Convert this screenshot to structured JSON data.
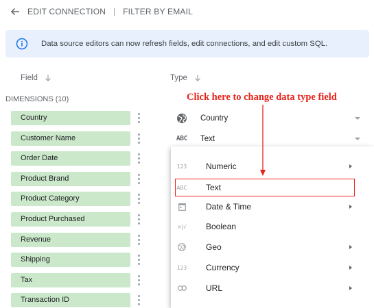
{
  "header": {
    "back_label": "EDIT CONNECTION",
    "filter_label": "FILTER BY EMAIL"
  },
  "banner": {
    "message": "Data source editors can now refresh fields, edit connections, and edit custom SQL."
  },
  "columns": {
    "field": "Field",
    "type": "Type"
  },
  "dimensions_label": "DIMENSIONS (10)",
  "annotation": "Click here to change data type field",
  "rows": [
    {
      "name": "Country",
      "type": "Country",
      "type_icon": "globe-icon"
    },
    {
      "name": "Customer Name",
      "type": "Text",
      "type_icon": "abc-icon"
    },
    {
      "name": "Order Date",
      "type": "",
      "type_icon": ""
    },
    {
      "name": "Product Brand",
      "type": "",
      "type_icon": ""
    },
    {
      "name": "Product Category",
      "type": "",
      "type_icon": ""
    },
    {
      "name": "Product Purchased",
      "type": "",
      "type_icon": ""
    },
    {
      "name": "Revenue",
      "type": "",
      "type_icon": ""
    },
    {
      "name": "Shipping",
      "type": "",
      "type_icon": ""
    },
    {
      "name": "Tax",
      "type": "",
      "type_icon": ""
    },
    {
      "name": "Transaction ID",
      "type": "",
      "type_icon": ""
    }
  ],
  "menu": [
    {
      "label": "Numeric",
      "icon": "numeric-icon",
      "glyph": "123",
      "submenu": true
    },
    {
      "label": "Text",
      "icon": "abc-icon",
      "glyph": "ABC",
      "submenu": false,
      "selected": true
    },
    {
      "label": "Date & Time",
      "icon": "calendar-icon",
      "glyph": "",
      "submenu": true
    },
    {
      "label": "Boolean",
      "icon": "boolean-icon",
      "glyph": "×|√",
      "submenu": false
    },
    {
      "label": "Geo",
      "icon": "globe-icon",
      "glyph": "",
      "submenu": true
    },
    {
      "label": "Currency",
      "icon": "currency-icon",
      "glyph": "123",
      "submenu": true
    },
    {
      "label": "URL",
      "icon": "link-icon",
      "glyph": "",
      "submenu": true
    }
  ],
  "colors": {
    "accent_red": "#e8231c",
    "chip_green": "#cbe8cb",
    "banner_blue": "#e8f0fe",
    "info_blue": "#1a73e8"
  }
}
